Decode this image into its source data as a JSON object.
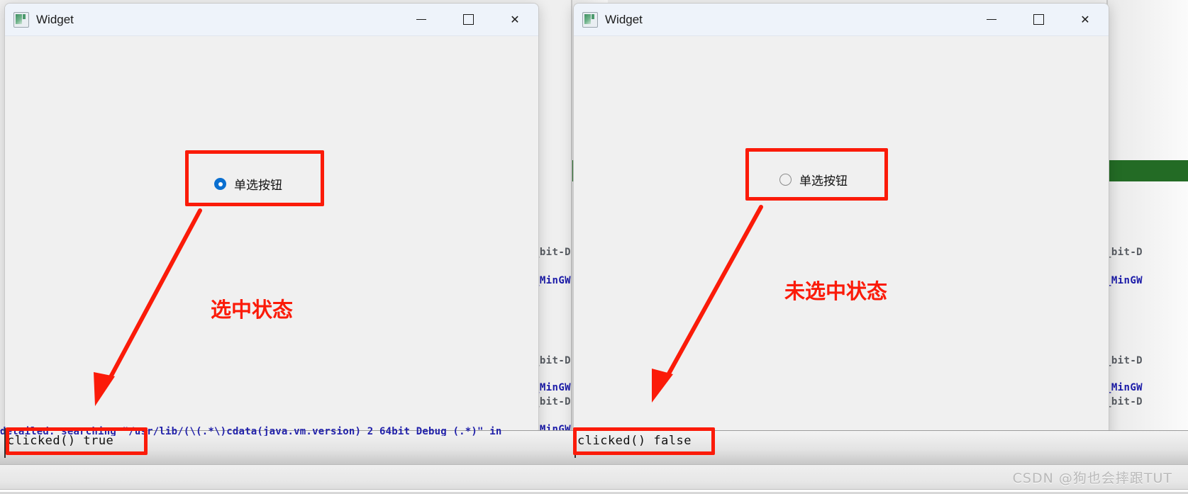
{
  "windows": [
    {
      "id": "left",
      "title": "Widget",
      "icon": "app-window-icon",
      "caption": {
        "minimize": "—",
        "maximize": "□",
        "close": "✕"
      },
      "radio": {
        "label": "单选按钮",
        "checked": true,
        "state_note": "选中状态"
      },
      "console_output": "clicked() true"
    },
    {
      "id": "right",
      "title": "Widget",
      "icon": "app-window-icon",
      "caption": {
        "minimize": "—",
        "maximize": "□",
        "close": "✕"
      },
      "radio": {
        "label": "单选按钮",
        "checked": false,
        "state_note": "未选中状态"
      },
      "console_output": "clicked() false"
    }
  ],
  "background": {
    "console_line_partial": "detailed: searching \"/usr/lib/(\\(.*\\)cdata(java.vm.version)_2_64bit_Debug_(.*)\" in",
    "code_fragments": [
      "_bit-D",
      "_MinGW",
      "_bit-D",
      "_MinGW",
      "_bit-D",
      "_MinGW"
    ]
  },
  "watermark": "CSDN @狗也会摔跟TUT",
  "colors": {
    "annotation_red": "#fb1b09",
    "radio_blue": "#0a6fd0",
    "titlebar_blue": "#eef3fa",
    "window_bg": "#f0f0f0",
    "accent_green": "#236b25"
  }
}
